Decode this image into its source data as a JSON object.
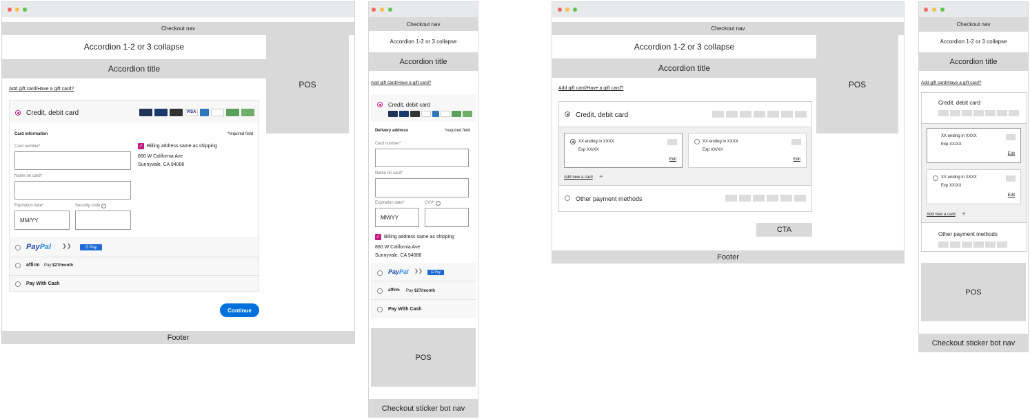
{
  "nav": {
    "title": "Checkout nav"
  },
  "accordion": {
    "collapse": "Accordion 1-2 or 3 collapse",
    "title": "Accordion title"
  },
  "pos": "POS",
  "footer": "Footer",
  "sticker": "Checkout sticker bot nav",
  "gift_link": "Add gift card/Have a gift card?",
  "payment": {
    "credit_debit": "Credit, debit card",
    "card_information": "Card information",
    "delivery_address": "Delivery address",
    "required": "*required field",
    "card_number": "Card number*",
    "name_on_card": "Name on card*",
    "expiration": "Expiration date*",
    "security": "Security code",
    "cvv": "CVV*",
    "mmyy": "MM/YY",
    "billing_same": "Billing address same as shipping",
    "address_line1": "860 W California Ave",
    "address_line2": "Sunnyvale, CA 94086",
    "paypal_pay": "Pay",
    "paypal_pal": "Pal",
    "gpay": "G Pay",
    "affirm": "affirm",
    "affirm_pay": "Pay",
    "affirm_amount": "$27/month",
    "pay_with_cash": "Pay With Cash",
    "continue": "Continue",
    "saved_card": "XX ending in XXXX",
    "exp": "Exp XX/XX",
    "edit": "Edit",
    "add_new_card": "Add new a card",
    "other_methods": "Other payment methods",
    "cta": "CTA"
  },
  "colors": {
    "accent": "#c21b7f",
    "button": "#0071dc",
    "placeholder": "#d9d9d9"
  }
}
